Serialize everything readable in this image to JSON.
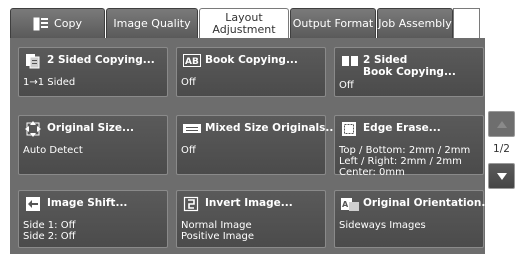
{
  "tabs": [
    {
      "label": "Copy",
      "icon": "copy-icon",
      "active": false
    },
    {
      "label": "Image Quality",
      "active": false
    },
    {
      "label_line1": "Layout",
      "label_line2": "Adjustment",
      "active": true
    },
    {
      "label": "Output Format",
      "active": false
    },
    {
      "label": "Job Assembly",
      "active": false
    }
  ],
  "tiles": [
    {
      "title": "2 Sided Copying...",
      "icon": "two-sided-icon",
      "values": [
        "1→1 Sided"
      ]
    },
    {
      "title": "Book Copying...",
      "icon": "ab-book-icon",
      "values": [
        "Off"
      ]
    },
    {
      "title_line1": "2 Sided",
      "title_line2": "Book Copying...",
      "icon": "open-book-icon",
      "values": [
        "Off"
      ]
    },
    {
      "title": "Original Size...",
      "icon": "original-size-icon",
      "values": [
        "Auto Detect"
      ]
    },
    {
      "title": "Mixed Size Originals...",
      "icon": "mixed-size-icon",
      "values": [
        "Off"
      ]
    },
    {
      "title": "Edge Erase...",
      "icon": "edge-erase-icon",
      "values": [
        "Top / Bottom: 2mm / 2mm",
        "Left / Right: 2mm / 2mm",
        "Center: 0mm"
      ]
    },
    {
      "title": "Image Shift...",
      "icon": "image-shift-icon",
      "values": [
        "Side 1: Off",
        "Side 2: Off"
      ]
    },
    {
      "title": "Invert Image...",
      "icon": "invert-image-icon",
      "values": [
        "Normal Image",
        "Positive Image"
      ]
    },
    {
      "title": "Original Orientation...",
      "icon": "orientation-icon",
      "values": [
        "Sideways Images"
      ]
    }
  ],
  "pager": {
    "indicator": "1/2"
  },
  "colors": {
    "tile_bg": "#555555",
    "panel_bg": "#6d6d6d",
    "tab_bg": "#6a6a6a",
    "active_tab_bg": "#ffffff"
  }
}
